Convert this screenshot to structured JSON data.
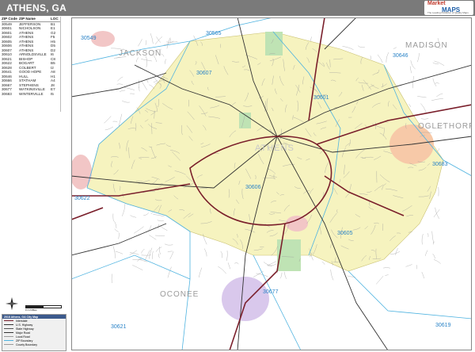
{
  "header": {
    "title": "ATHENS, GA",
    "logo_line1": "Market",
    "logo_line2": "MAPS",
    "logo_tagline": "The Leading Publisher of Quality Maps"
  },
  "zip_table": {
    "headers": [
      "ZIP Code",
      "ZIP Name",
      "LOC"
    ],
    "rows": [
      [
        "30549",
        "JEFFERSON",
        "B1"
      ],
      [
        "30601",
        "NICHOLSON",
        "E1"
      ],
      [
        "30601",
        "ATHENS",
        "G2"
      ],
      [
        "30602",
        "ATHENS",
        "F5"
      ],
      [
        "30605",
        "ATHENS",
        "H5"
      ],
      [
        "30606",
        "ATHENS",
        "D5"
      ],
      [
        "30607",
        "ATHENS",
        "D2"
      ],
      [
        "30610",
        "ARNOLDSVILLE",
        "I6"
      ],
      [
        "30621",
        "BISHOP",
        "C8"
      ],
      [
        "30622",
        "BOGART",
        "B5"
      ],
      [
        "30628",
        "COLBERT",
        "I2"
      ],
      [
        "30641",
        "GOOD HOPE",
        "A8"
      ],
      [
        "30646",
        "HULL",
        "H1"
      ],
      [
        "30666",
        "STATHAM",
        "A4"
      ],
      [
        "30667",
        "STEPHENS",
        "J8"
      ],
      [
        "30677",
        "WATKINSVILLE",
        "E7"
      ],
      [
        "30683",
        "WINTERVILLE",
        "I5"
      ]
    ]
  },
  "map": {
    "counties": [
      "JACKSON",
      "MADISON",
      "OGLETHORPE",
      "OCONEE"
    ],
    "city_label": "ATHENS",
    "zip_labels": [
      "30549",
      "30565",
      "30607",
      "30646",
      "30601",
      "30683",
      "30622",
      "30606",
      "30605",
      "30677",
      "30621",
      "30619"
    ],
    "colors": {
      "athens_fill": "#f6f3bf",
      "zip_boundary": "#4fb3e0",
      "interstate": "#7a1f2b",
      "major_road": "#333333",
      "city_pink": "#f2c6c6",
      "city_orange": "#f7c9a8",
      "city_purple": "#d9c8ec",
      "park_green": "#bfe3b4"
    }
  },
  "legend": {
    "title": "2018 Athens, GA City Map",
    "items": [
      "Interstate",
      "U.S. Highway",
      "State Highway",
      "Major Road",
      "Local Road",
      "ZIP Boundary",
      "County Boundary"
    ]
  },
  "scale_label": "0  1  2 Miles"
}
